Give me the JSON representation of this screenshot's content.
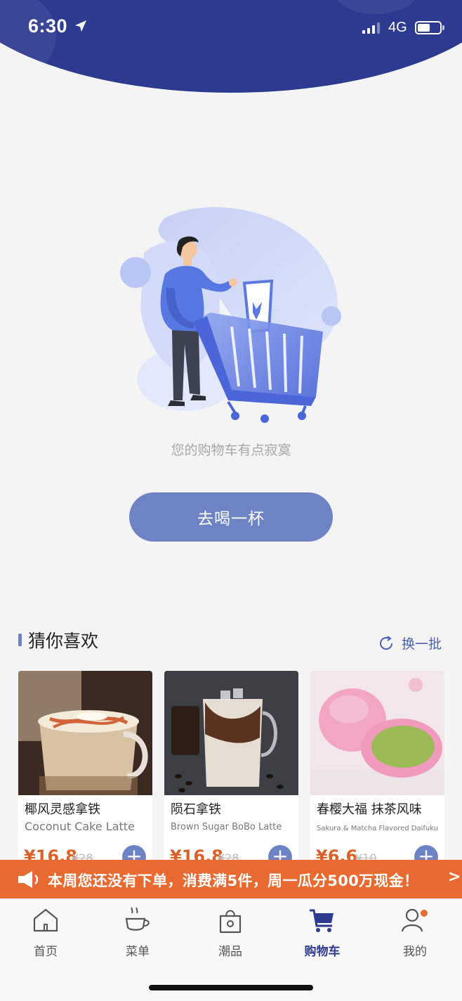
{
  "status_bar": {
    "time": "6:30",
    "network": "4G",
    "battery_level": 0.55
  },
  "empty_cart": {
    "message": "您的购物车有点寂寞",
    "button_label": "去喝一杯"
  },
  "recommendations": {
    "title": "猜你喜欢",
    "refresh_label": "换一批",
    "items": [
      {
        "name": "椰风灵感拿铁",
        "english_name": "Coconut Cake Latte",
        "price": "¥16.8",
        "original_price": "¥28"
      },
      {
        "name": "陨石拿铁",
        "english_name": "Brown Sugar BoBo Latte",
        "price": "¥16.8",
        "original_price": "¥28"
      },
      {
        "name": "春樱大福  抹茶风味",
        "english_name": "Sakura & Matcha Flavored Daifuku",
        "price": "¥6.6",
        "original_price": "¥10"
      }
    ]
  },
  "promo_banner": {
    "text": "本周您还没有下单，消费满5件，周一瓜分500万现金！",
    "arrow": ">"
  },
  "tabbar": {
    "tabs": [
      {
        "label": "首页",
        "icon": "home-icon"
      },
      {
        "label": "菜单",
        "icon": "cup-icon"
      },
      {
        "label": "潮品",
        "icon": "bag-icon"
      },
      {
        "label": "购物车",
        "icon": "cart-icon",
        "active": true
      },
      {
        "label": "我的",
        "icon": "user-icon"
      }
    ]
  },
  "colors": {
    "brand": "#2c3a8f",
    "accent": "#6e83c4",
    "promo": "#e86a30",
    "price": "#d9622b"
  }
}
